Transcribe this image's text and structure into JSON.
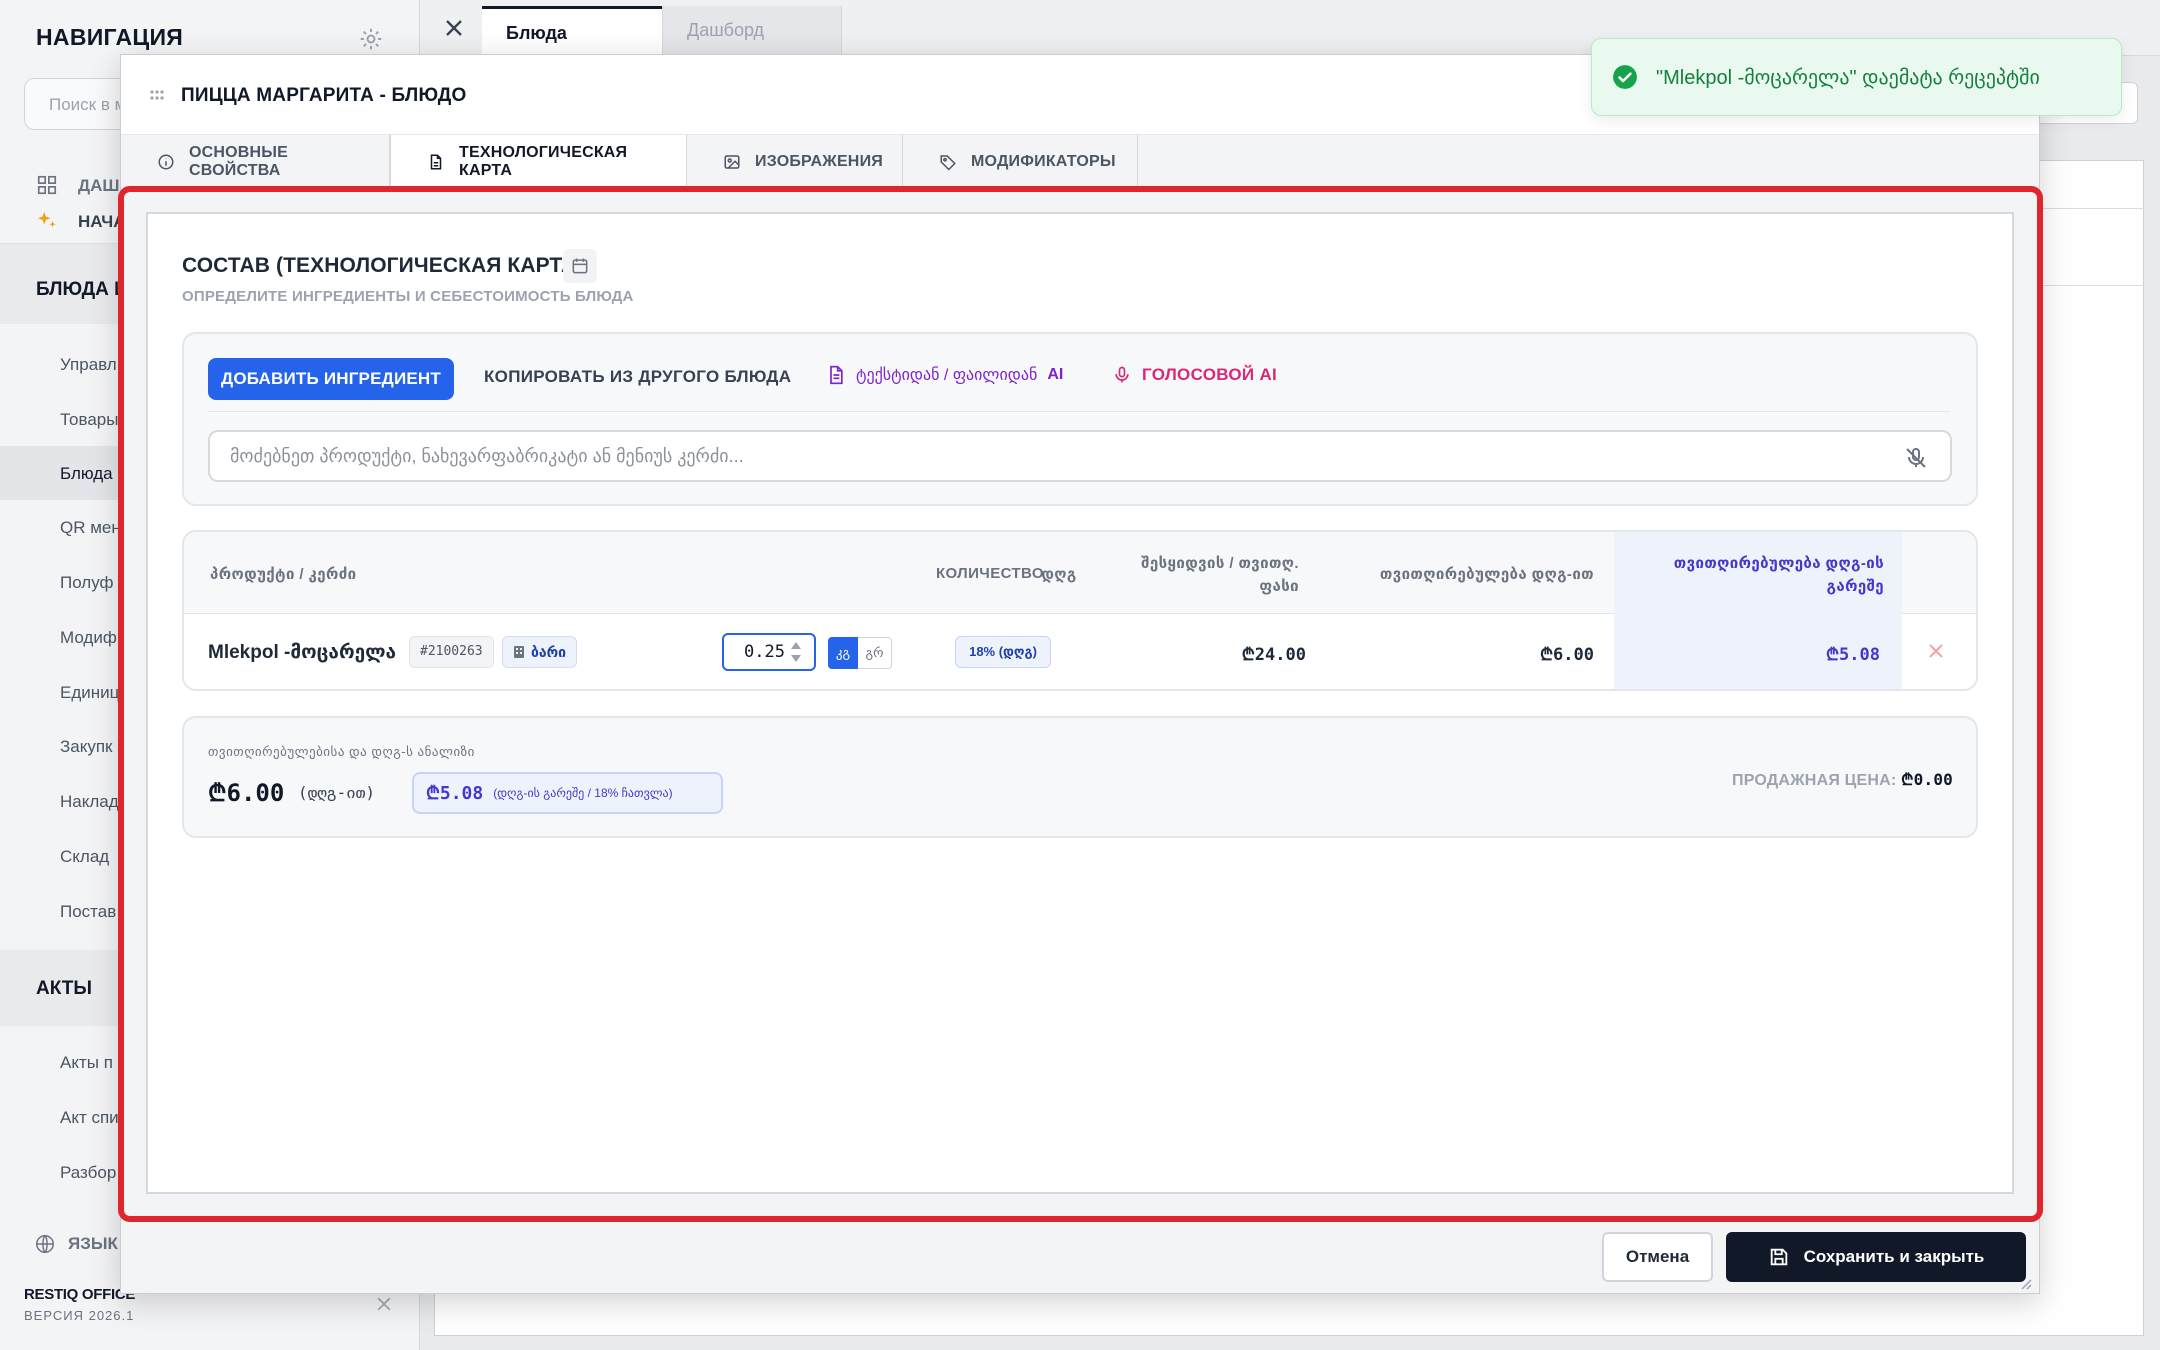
{
  "sidebar": {
    "title": "НАВИГАЦИЯ",
    "search_placeholder": "Поиск в м",
    "top_items": [
      {
        "label": "ДАШ",
        "icon": "grid-icon"
      },
      {
        "label": "НАЧА",
        "icon": "sparkle-icon"
      }
    ],
    "section_dishes": "БЛЮДА И",
    "items": [
      "Управл",
      "Товары",
      "Блюда",
      "QR мен",
      "Полуф",
      "Модиф",
      "Единиц",
      "Закупк",
      "Наклад",
      "Склад",
      "Постав"
    ],
    "active_item": "Блюда",
    "section_acts": "АКТЫ",
    "act_items": [
      "Акты п",
      "Акт спи",
      "Разбор"
    ],
    "language": "ЯЗЫК",
    "brand": "RESTIQ OFFICE",
    "version": "ВЕРСИЯ 2026.1"
  },
  "tabs": [
    {
      "label": "Блюда",
      "active": true
    },
    {
      "label": "Дашборд",
      "active": false
    }
  ],
  "modal": {
    "title": "ПИЦЦА МАРГАРИТА - БЛЮДО",
    "tabs": [
      {
        "label": "ОСНОВНЫЕ СВОЙСТВА",
        "icon": "info-icon"
      },
      {
        "label": "ТЕХНОЛОГИЧЕСКАЯ КАРТА",
        "icon": "document-icon"
      },
      {
        "label": "ИЗОБРАЖЕНИЯ",
        "icon": "image-icon"
      },
      {
        "label": "МОДИФИКАТОРЫ",
        "icon": "tag-icon"
      }
    ],
    "section": {
      "title": "СОСТАВ (ТЕХНОЛОГИЧЕСКАЯ КАРТА)",
      "subtitle": "ОПРЕДЕЛИТЕ ИНГРЕДИЕНТЫ И СЕБЕСТОИМОСТЬ БЛЮДА"
    },
    "toolbar": {
      "add_label": "ДОБАВИТЬ ИНГРЕДИЕНТ",
      "copy_label": "КОПИРОВАТЬ ИЗ ДРУГОГО БЛЮДА",
      "ai_text_label": "ტექსტიდან / ფაილიდან",
      "ai_suffix": "AI",
      "voice_label": "ГОЛОСОВОЙ AI",
      "search_placeholder": "მოძებნეთ პროდუქტი, ნახევარფაბრიკატი ან მენიუს კერძი..."
    },
    "table": {
      "headers": {
        "product": "პროდუქტი / კერძი",
        "quantity": "КОЛИЧЕСТВО",
        "vat": "დღგ",
        "purchase": "შესყიდვის / თვითღ. ფასი",
        "cost_with_vat": "თვითღირებულება დღგ-ით",
        "cost_without_vat": "თვითღირებულება დღგ-ის გარეშე"
      },
      "rows": [
        {
          "name": "Mlekpol -მოცარელა",
          "code": "#2100263",
          "stock_label": "ბარი",
          "quantity": "0.25",
          "unit_selected": "კგ",
          "unit_other": "გრ",
          "vat": "18% (დღგ)",
          "purchase_price": "₾24.00",
          "cost_with_vat": "₾6.00",
          "cost_without_vat": "₾5.08"
        }
      ]
    },
    "summary": {
      "label": "თვითღირებულებისა და დღგ-ს ანალიზი",
      "total_with_vat": "₾6.00",
      "total_with_vat_note": "(დღგ-ით)",
      "total_without_vat": "₾5.08",
      "total_without_vat_note": "(დღგ-ის გარეშე / 18% ჩათვლა)",
      "sell_price_label": "ПРОДАЖНАЯ ЦЕНА:",
      "sell_price_value": "₾0.00"
    },
    "footer": {
      "cancel_label": "Отмена",
      "save_label": "Сохранить и закрыть"
    }
  },
  "toast": {
    "message": "\"Mlekpol -მოცარელა\" დაემატა რეცეპტში"
  },
  "colors": {
    "accent": "#2563eb",
    "highlight_border": "#e0262c",
    "toast_green": "#15803d",
    "ai_purple": "#7e22ce",
    "voice_pink": "#db2777",
    "no_vat_indigo": "#4338ca"
  }
}
